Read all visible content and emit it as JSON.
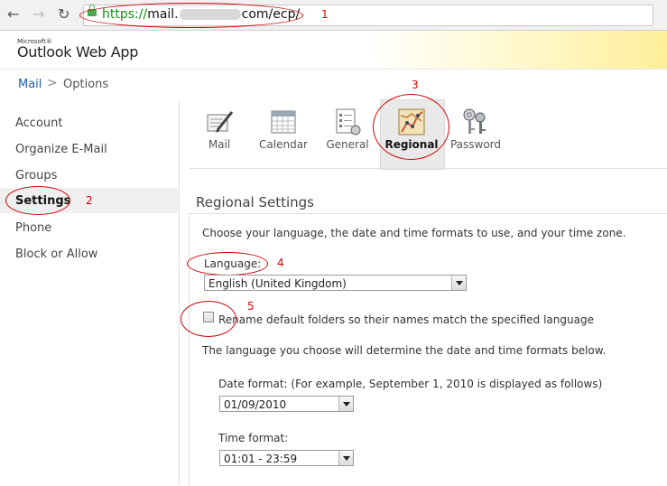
{
  "browser": {
    "url_scheme": "https://",
    "url_host_prefix": "mail.",
    "url_host_suffix": "com/ecp/",
    "back_icon": "back-arrow-icon",
    "forward_icon": "forward-arrow-icon",
    "reload_icon": "reload-icon",
    "lock_icon": "lock-icon"
  },
  "app": {
    "logo_small": "Microsoft®",
    "logo_main": "Outlook Web App"
  },
  "breadcrumb": {
    "mail": "Mail",
    "separator": ">",
    "options": "Options"
  },
  "sidebar": {
    "items": [
      {
        "label": "Account"
      },
      {
        "label": "Organize E-Mail"
      },
      {
        "label": "Groups"
      },
      {
        "label": "Settings",
        "selected": true
      },
      {
        "label": "Phone"
      },
      {
        "label": "Block or Allow"
      }
    ]
  },
  "tabs": [
    {
      "label": "Mail",
      "icon": "mail-pencil-icon"
    },
    {
      "label": "Calendar",
      "icon": "calendar-icon"
    },
    {
      "label": "General",
      "icon": "general-document-icon"
    },
    {
      "label": "Regional",
      "icon": "regional-map-icon",
      "selected": true
    },
    {
      "label": "Password",
      "icon": "keys-icon"
    }
  ],
  "regional": {
    "title": "Regional Settings",
    "intro": "Choose your language, the date and time formats to use, and your time zone.",
    "language_label": "Language:",
    "language_value": "English (United Kingdom)",
    "rename_label": "Rename default folders so their names match the specified language",
    "rename_checked": false,
    "formats_note": "The language you choose will determine the date and time formats below.",
    "date_label": "Date format: (For example, September 1, 2010 is displayed as follows)",
    "date_value": "01/09/2010",
    "time_label": "Time format:",
    "time_value": "01:01 - 23:59"
  },
  "annotations": {
    "n1": "1",
    "n2": "2",
    "n3": "3",
    "n4": "4",
    "n5": "5",
    "color": "#d40000"
  },
  "colors": {
    "link": "#1f5ea8",
    "secure_green": "#109010",
    "header_gold": "#ffef9a"
  }
}
